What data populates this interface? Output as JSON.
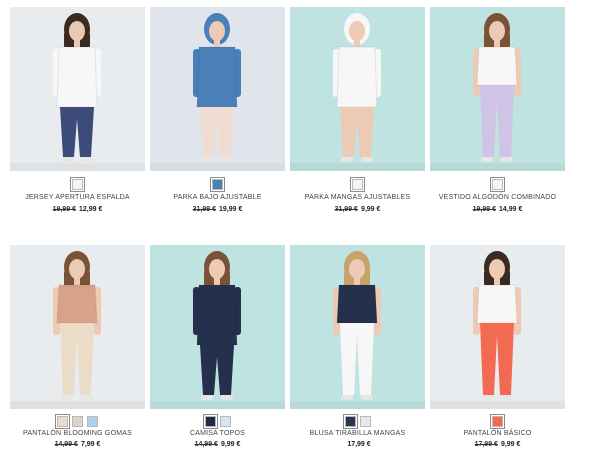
{
  "products": [
    {
      "name": "JERSEY APERTURA ESPALDA",
      "old_price": "19,99 €",
      "price": "12,99 €",
      "bg": "#e9ecef",
      "swatches": [
        {
          "color": "#f4f4f4",
          "label": "white"
        }
      ],
      "photo_icon": "model-white-sweater-back"
    },
    {
      "name": "PARKA BAJO AJUSTABLE",
      "old_price": "31,99 €",
      "price": "19,99 €",
      "bg": "#dfe5ea",
      "swatches": [
        {
          "color": "#4a7fb8",
          "label": "denim"
        }
      ],
      "photo_icon": "model-denim-parka"
    },
    {
      "name": "PARKA MANGAS AJUSTABLES",
      "old_price": "31,99 €",
      "price": "9,99 €",
      "bg": "#bfe3e1",
      "swatches": [
        {
          "color": "#f4f4f4",
          "label": "white"
        }
      ],
      "photo_icon": "model-white-parka"
    },
    {
      "name": "VESTIDO ALGODÓN COMBINADO",
      "old_price": "19,99 €",
      "price": "14,99 €",
      "bg": "#bfe3e1",
      "swatches": [
        {
          "color": "#f4f4f4",
          "label": "white"
        }
      ],
      "photo_icon": "model-floral-dress"
    },
    {
      "name": "PANTALÓN BLOOMING GOMAS",
      "old_price": "14,99 €",
      "price": "7,99 €",
      "bg": "#e9ecef",
      "swatches": [
        {
          "color": "#eadccb",
          "label": "beige"
        },
        {
          "color": "#dcd4c6",
          "label": "stone"
        },
        {
          "color": "#a9d1ea",
          "label": "light-blue"
        }
      ],
      "photo_icon": "model-beige-trousers"
    },
    {
      "name": "CAMISA TOPOS",
      "old_price": "14,99 €",
      "price": "9,99 €",
      "bg": "#bfe3e1",
      "swatches": [
        {
          "color": "#1f2a44",
          "label": "navy-dots"
        },
        {
          "color": "#d9e6f2",
          "label": "light"
        }
      ],
      "photo_icon": "model-navy-shirt"
    },
    {
      "name": "BLUSA TIRABILLA MANGAS",
      "old_price": "",
      "price": "17,99 €",
      "bg": "#bfe3e1",
      "swatches": [
        {
          "color": "#2a3352",
          "label": "navy"
        },
        {
          "color": "#e8e8e8",
          "label": "white"
        }
      ],
      "photo_icon": "model-navy-blouse"
    },
    {
      "name": "PANTALÓN BÁSICO",
      "old_price": "17,99 €",
      "price": "9,99 €",
      "bg": "#e9ecef",
      "swatches": [
        {
          "color": "#f26a52",
          "label": "coral"
        }
      ],
      "photo_icon": "model-coral-trousers"
    }
  ]
}
